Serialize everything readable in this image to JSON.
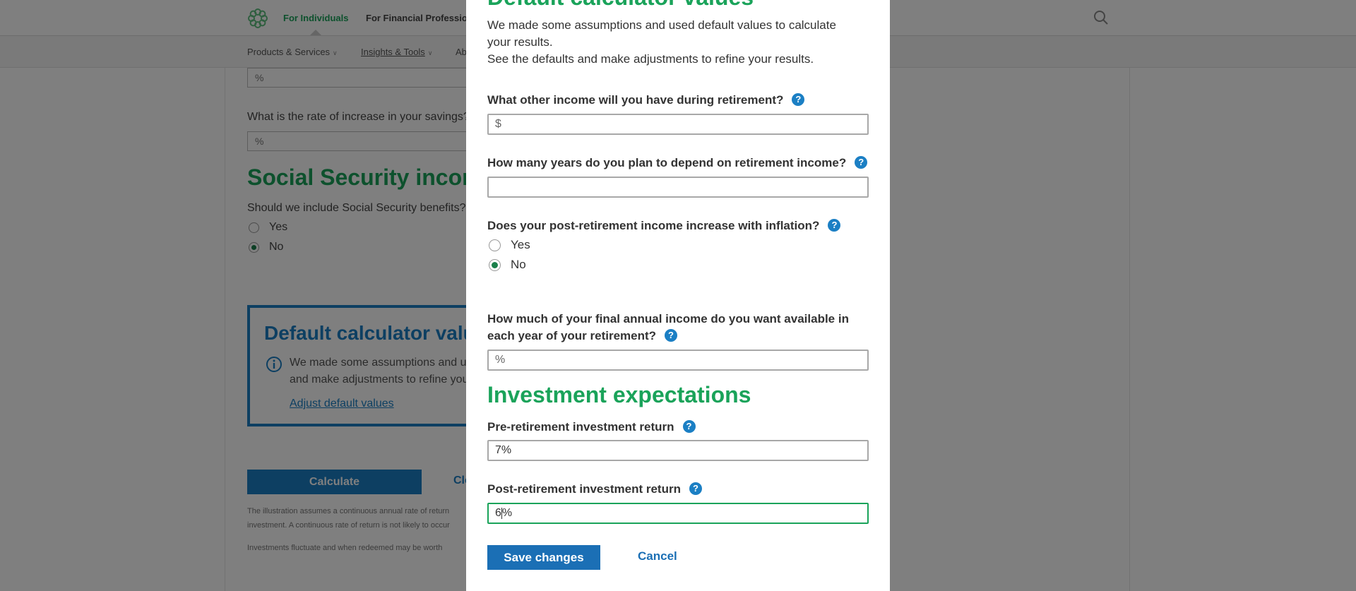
{
  "colors": {
    "brand_green": "#1aa35a",
    "brand_blue": "#1b7fc4",
    "button_blue": "#1b6fb5",
    "focus_border": "#1aa35a"
  },
  "header": {
    "logo_icon": "flower-logo-icon",
    "nav": [
      "For Individuals",
      "For Financial Professionals"
    ],
    "search_icon": "search-icon"
  },
  "subnav": [
    "Products & Services",
    "Insights & Tools",
    "Ab"
  ],
  "background": {
    "input_percent_1": "%",
    "savings_question": "What is the rate of increase in your savings?",
    "input_percent_2": "%",
    "social_security_heading": "Social Security income",
    "social_security_question": "Should we include Social Security benefits?",
    "radio_yes": "Yes",
    "radio_no": "No",
    "default_box": {
      "title": "Default calculator values",
      "text_line1": "We made some assumptions and used default values",
      "text_line2": "and make adjustments to refine your results.",
      "link": "Adjust default values"
    },
    "calculate_button": "Calculate",
    "clear_link": "Cle",
    "fine_print_1": "The illustration assumes a continuous annual rate of return",
    "fine_print_2": "investment. A continuous rate of return is not likely to occur",
    "fine_print_3": "Investments fluctuate and when redeemed may be worth"
  },
  "modal": {
    "title": "Default calculator values",
    "intro_line1": "We made some assumptions and used default values to calculate your results.",
    "intro_line2": "See the defaults and make adjustments to refine your results.",
    "q_other_income": "What other income will you have during retirement?",
    "other_income_prefix": "$",
    "other_income_value": "",
    "q_years": "How many years do you plan to depend on retirement income?",
    "years_value": "",
    "q_inflation": "Does your post-retirement income increase with inflation?",
    "inflation_yes": "Yes",
    "inflation_no": "No",
    "inflation_selected": "No",
    "q_final_income_line1": "How much of your final annual income do you want available in",
    "q_final_income_line2": "each year of your retirement?",
    "final_income_value": "%",
    "investment_heading": "Investment expectations",
    "q_pre_return": "Pre-retirement investment return",
    "pre_return_value": "7%",
    "q_post_return": "Post-retirement investment return",
    "post_return_value_before_caret": "6",
    "post_return_value_after_caret": "%",
    "save_button": "Save changes",
    "cancel_link": "Cancel",
    "help_glyph": "?"
  }
}
